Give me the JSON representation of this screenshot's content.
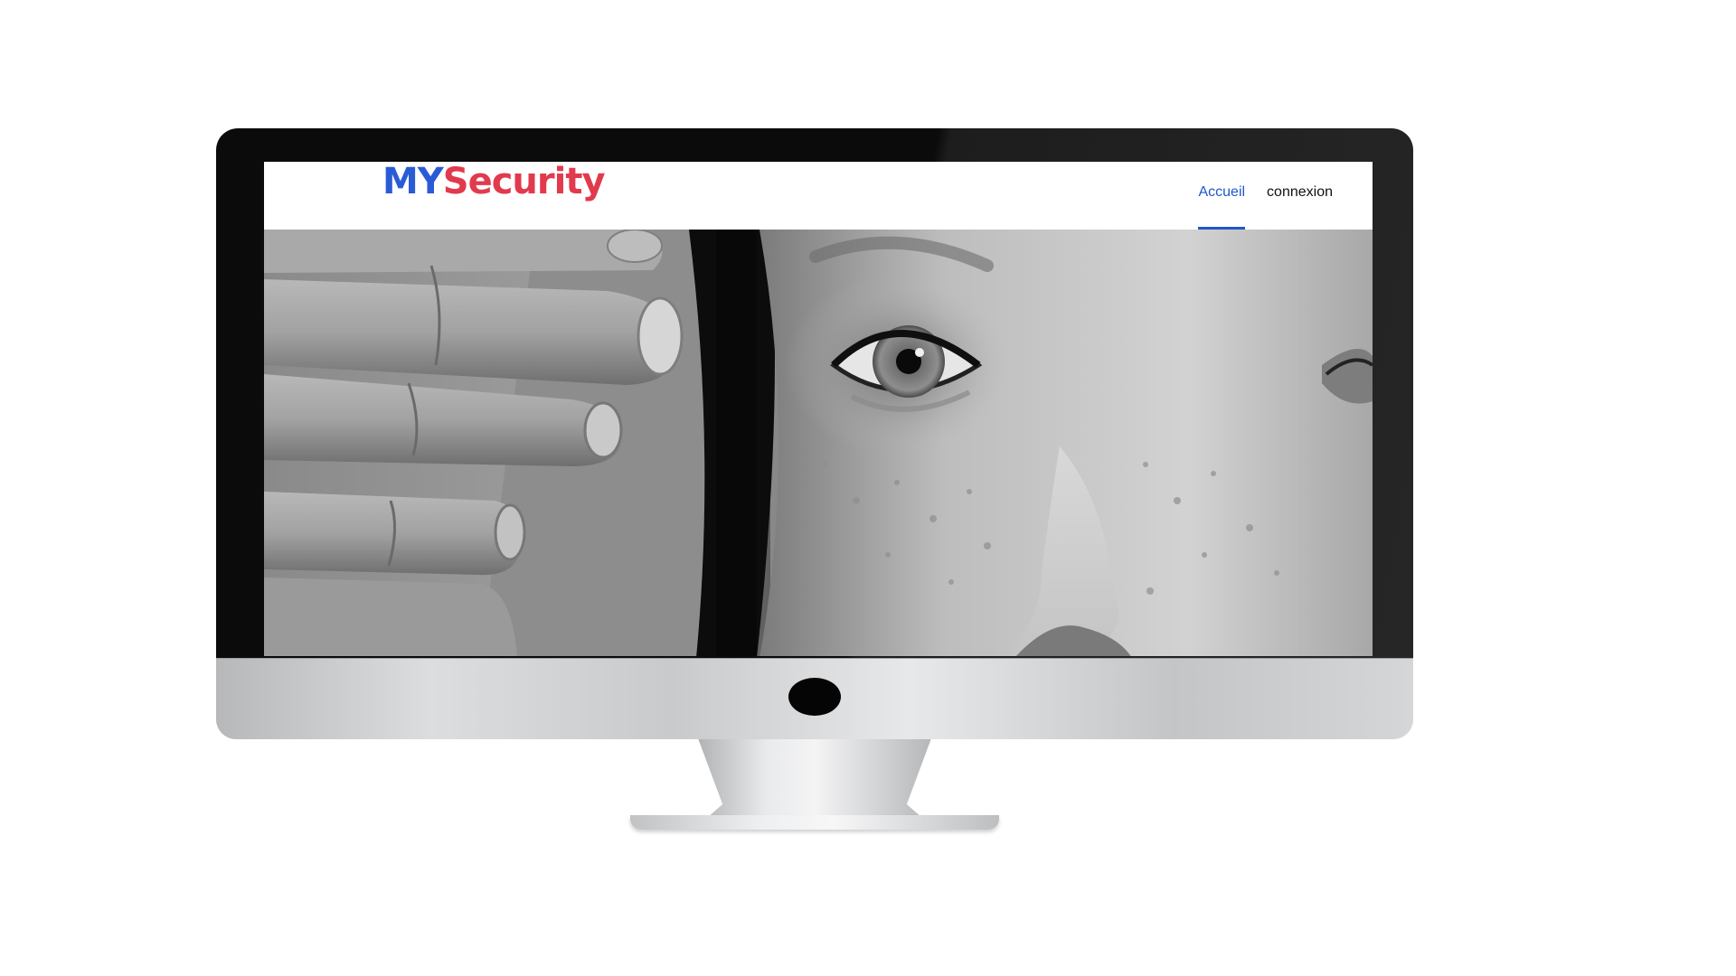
{
  "site": {
    "logo_part_a": "MY",
    "logo_part_b": "Security"
  },
  "nav": {
    "items": [
      {
        "label": "Accueil",
        "active": true
      },
      {
        "label": "connexion",
        "active": false
      }
    ]
  },
  "hero": {
    "image": "black-and-white photo: a hand covering a woman's mouth, woman's wide open eye",
    "tone": "grayscale"
  },
  "colors": {
    "logo_blue": "#2a5bd7",
    "logo_red": "#e23a4d",
    "nav_active": "#1f57c9",
    "bezel": "#0b0b0b",
    "chin": "#d0d1d3"
  }
}
